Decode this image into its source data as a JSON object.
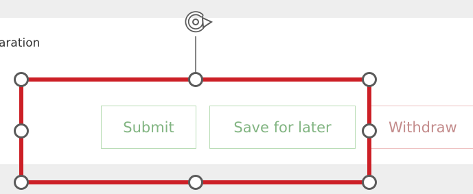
{
  "section": {
    "label": "aration"
  },
  "buttons": {
    "submit": "Submit",
    "save_for_later": "Save for later",
    "withdraw": "Withdraw"
  },
  "selection": {
    "border_color": "#cc1f26",
    "handle_fill": "#ffffff",
    "handle_stroke": "#5a5a5a",
    "rotate_icon": "rotate-icon"
  },
  "colors": {
    "canvas": "#eeeeee",
    "panel": "#ffffff",
    "primary_button_border": "#b7dcb4",
    "primary_button_text": "#82b582",
    "danger_button_border": "#edc0c0",
    "danger_button_text": "#c38b8b"
  }
}
